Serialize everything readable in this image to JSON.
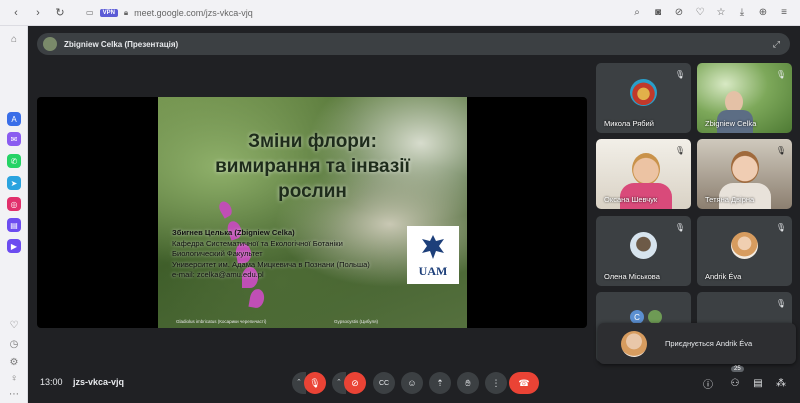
{
  "browser": {
    "url": "meet.google.com/jzs-vkca-vjq",
    "vpn_label": "VPN"
  },
  "meet": {
    "presenter_label": "Zbigniew Celka (Презентація)",
    "time": "13:00",
    "meeting_code": "jzs-vkca-vjq",
    "participant_count": "25"
  },
  "slide": {
    "title_lines": [
      "Зміни флори:",
      "вимирання та інвазії",
      "рослин"
    ],
    "author": "Збигнев Целька (Zbigniew Celka)",
    "body_lines": [
      "Кафедра Систематичної та Екологічної Ботаніки",
      "Биологический Факультет",
      "Университет им. Адама Мицкевича в Познани (Польша)",
      "e-mail: zcelka@amu.edu.pl"
    ],
    "logo_text": "UAM",
    "caption_left": "Gladiolus imbricatus (Косарики черепичасті)",
    "caption_right": "Gypsocystis (Цибуля)"
  },
  "tiles": [
    {
      "name": "Микола Рябий"
    },
    {
      "name": "Zbigniew Celka"
    },
    {
      "name": "Оксана Шевчук"
    },
    {
      "name": "Тетяна Двірна"
    },
    {
      "name": "Олена Міськова"
    },
    {
      "name": "Andrik Éva"
    },
    {
      "name": ""
    },
    {
      "name": ""
    }
  ],
  "notification": {
    "text": "Приєднується Andrik Éva"
  },
  "colors": {
    "meet_bg": "#202124",
    "tile_bg": "#3c4043",
    "red": "#ea4335"
  }
}
